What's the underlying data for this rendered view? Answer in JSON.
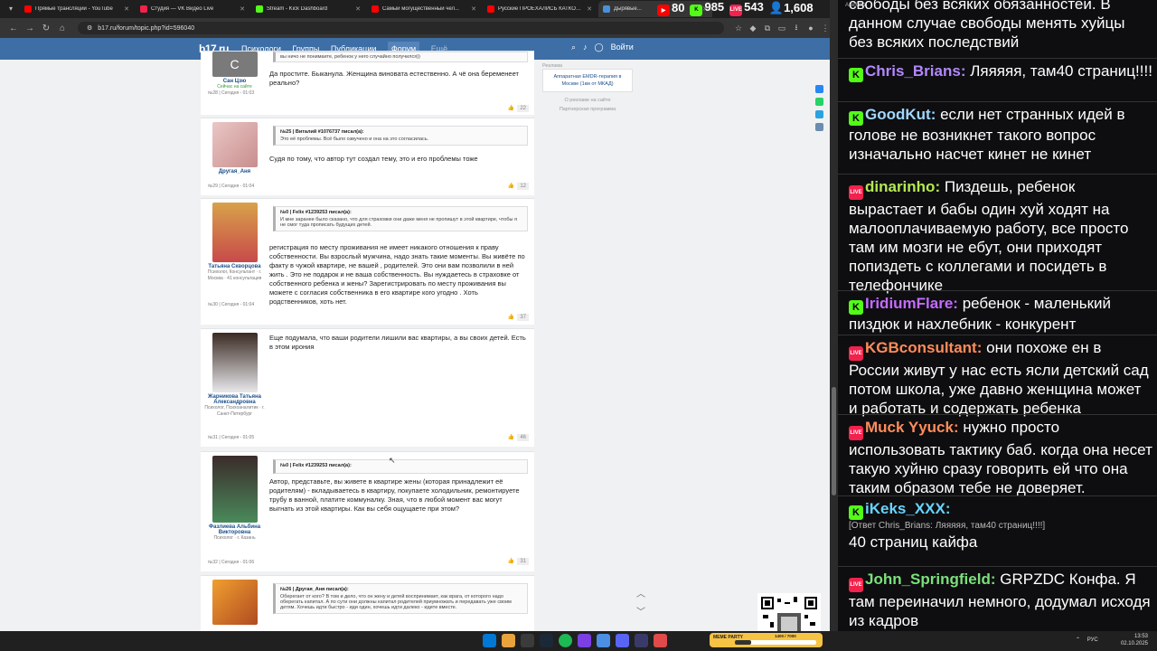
{
  "browser": {
    "tabs": [
      {
        "title": "Прямые трансляции - YouTube",
        "color": "#ff0000",
        "active": false
      },
      {
        "title": "Студия — VK Видео Live",
        "color": "#f2224d",
        "active": false
      },
      {
        "title": "Stream - Kick Dashboard",
        "color": "#53fc18",
        "active": false
      },
      {
        "title": "Самый могущественный чел...",
        "color": "#ff0000",
        "active": false
      },
      {
        "title": "Русские ПРОЕХАЛИСЬ КАТКОЙ...",
        "color": "#ff0000",
        "active": false
      },
      {
        "title": "Дырявые...",
        "color": "#4a90d9",
        "active": true
      }
    ],
    "url": "b17.ru/forum/topic.php?id=596040"
  },
  "site": {
    "logo": "b17.ru",
    "nav": [
      "Психологи",
      "Группы",
      "Публикации",
      "Форум",
      "Ещё..."
    ],
    "login": "Войти"
  },
  "posts": [
    {
      "author": "Сан Цзю",
      "author_sub": "Сейчас на сайте",
      "meta": "№28 | Сегодня - 01:03",
      "quote_head": "",
      "quote": "вы ничо не понимаете, ребенок у него случайно получился))",
      "text": "Да простите. Быканула. Женщина виновата естественно. А чё она беременеет реально?",
      "likes": "22"
    },
    {
      "author": "Другая_Аня",
      "author_sub": "",
      "meta": "№29 | Сегодня - 01:04",
      "quote_head": "№25 | Виталий #1076737 писал(а):",
      "quote": "Это её проблемы. Всё было озвучено и она на это согласилась.",
      "text": "Судя по тому, что автор тут создал тему, это и его проблемы тоже",
      "likes": "12"
    },
    {
      "author": "Татьяна Скворцова",
      "author_sub": "Психолог, Консультант · г. Москва · 41 консультация",
      "meta": "№30 | Сегодня - 01:04",
      "quote_head": "№0 | Felix #1239253 писал(а):",
      "quote": "И мне заранее было сказано, что для страховки они даже меня не пропишут в этой квартире, чтобы я не смог туда прописать будущих детей.",
      "text": "регистрация по месту проживания не имеет никакого отношения к праву собственности. Вы взрослый мужчина, надо знать такие моменты. Вы живёте по факту в чужой квартире, не вашей , родителей. Это они вам позволили в ней жить . Это не подарок и не ваша собственность. Вы нуждаетесь в страховке от собственного ребенка и жены? Зарегистрировать по месту проживания вы можете с согласия собственника в его квартире кого угодно . Хоть родственников, хоть нет.",
      "likes": "37"
    },
    {
      "author": "Жарникова Татьяна Александровна",
      "author_sub": "Психолог, Психоаналитик · г. Санкт-Петербург",
      "meta": "№31 | Сегодня - 01:05",
      "quote_head": "",
      "quote": "",
      "text": "Еще подумала, что ваши родители лишили вас квартиры, а вы своих детей. Есть в этом ирония",
      "likes": "46"
    },
    {
      "author": "Фазлиева Альбина Викторовна",
      "author_sub": "Психолог · г. Казань",
      "meta": "№32 | Сегодня - 01:06",
      "quote_head": "№0 | Felix #1239253 писал(а):",
      "quote": "",
      "text": "Автор, представьте, вы живете в квартире жены (которая принадлежит её родителям) - вкладываетесь в квартиру, покупаете холодильник, ремонтируете трубу в ванной, платите коммуналку. Зная, что в любой момент вас могут выгнать из этой квартиры. Как вы себя ощущаете при этом?",
      "likes": "31"
    },
    {
      "author": "",
      "author_sub": "",
      "meta": "",
      "quote_head": "№26 | Другая_Аня писал(а):",
      "quote": "Оберегает от кого? В том и дело, что он жену и детей воспринимает, как врага, от которого надо оберегать капитал. А по сути они должны капитал родителей приумножать и передавать уже своим детям. Хочешь идти быстро - иди один, хочешь идти далеко - идите вместе.",
      "text": "",
      "likes": ""
    }
  ],
  "ad": {
    "label": "Реклама",
    "text": "Аппаратная EMDR-терапия в Москве (1км от МКАД)",
    "link1": "О рекламе на сайте",
    "link2": "Партнерская программа"
  },
  "overlay": {
    "youtube": "80",
    "kick": "985",
    "vk": "543",
    "total": "1,608"
  },
  "chat": {
    "title": "AxelChat",
    "messages": [
      {
        "platform": "",
        "user": "",
        "text": "свободы без всяких обязанностей. В данном случае свободы менять хуйцы без всяких последствий",
        "color": "#fff"
      },
      {
        "platform": "kick",
        "user": "Chris_Brians:",
        "text": "Ляяяяя, там40 страниц!!!!",
        "color": "#b388ff"
      },
      {
        "platform": "kick",
        "user": "GoodKut:",
        "text": "если нет странных идей в голове не возникнет такого вопрос изначально насчет кинет не кинет",
        "color": "#a0d8ff"
      },
      {
        "platform": "vk",
        "user": "dinarinho:",
        "text": "Пиздешь, ребенок вырастает и бабы один хуй ходят на малооплачиваемую работу, все просто там им мозги не ебут, они приходят попиздеть с коллегами и посидеть в телефончике",
        "color": "#b5e853"
      },
      {
        "platform": "kick",
        "user": "IridiumFlare:",
        "text": "ребенок - маленький пиздюк и нахлебник - конкурент",
        "color": "#c46bff"
      },
      {
        "platform": "vk",
        "user": "KGBconsultant:",
        "text": "они похоже ен в России живут у нас есть ясли детский сад потом школа, уже давно женщина может и работать и содержать ребенка",
        "color": "#ff8c5a"
      },
      {
        "platform": "vk",
        "user": "Muck Yyuck:",
        "text": "нужно просто использовать тактику баб. когда она несет такую хуйню сразу говорить ей что она таким образом тебе не доверяет.",
        "color": "#ff8c5a"
      },
      {
        "platform": "kick",
        "user": "iKeks_XXX:",
        "reply": "[Ответ Chris_Brians: Ляяяяя, там40 страниц!!!!]",
        "text": "40 страниц кайфа",
        "color": "#67d4ff"
      },
      {
        "platform": "vk",
        "user": "John_Springfield:",
        "text": "GRPZDC Конфа. Я там переиначил немного, додумал исходя из кадров",
        "color": "#7be07b"
      }
    ]
  },
  "taskbar": {
    "meme_title": "MEME PARTY",
    "meme_progress": "1400 / 7000",
    "meme_fraction": 0.2,
    "lang": "РУС",
    "time": "13:53",
    "date": "02.10.2025"
  }
}
